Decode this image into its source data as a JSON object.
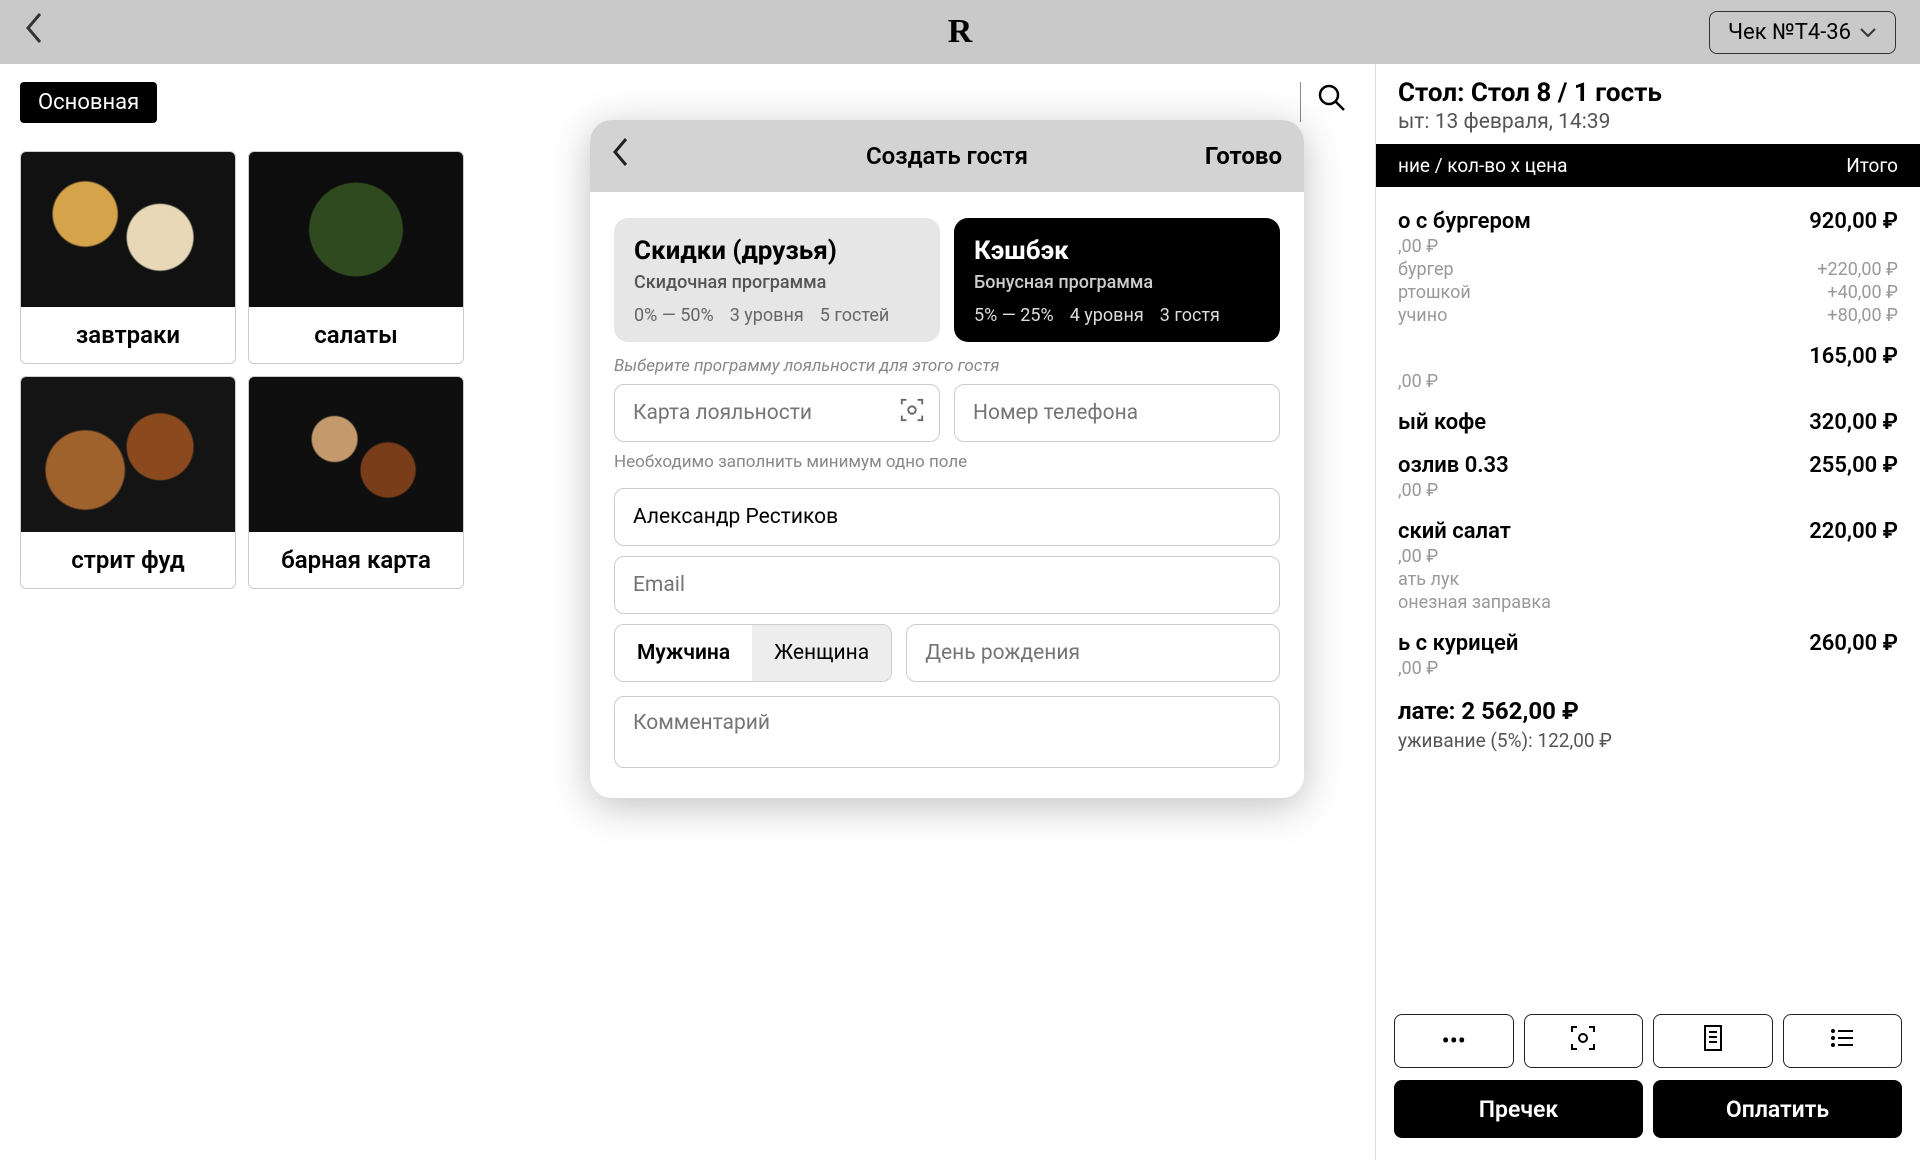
{
  "topbar": {
    "check_label": "Чек №Т4-36"
  },
  "menu": {
    "active_tab": "Основная",
    "categories": [
      {
        "label": "завтраки"
      },
      {
        "label": "салаты"
      },
      {
        "label": "стрит фуд"
      },
      {
        "label": "барная карта"
      }
    ]
  },
  "receipt": {
    "table_title": "Стол: Стол 8 / 1 гость",
    "opened": "ыт: 13 февраля, 14:39",
    "col_name": "ние / кол-во х цена",
    "col_total": "Итого",
    "items": [
      {
        "name": "о с бургером",
        "price": "920,00 ₽",
        "sub_price": ",00 ₽",
        "mods": [
          {
            "n": "бургер",
            "p": "+220,00 ₽"
          },
          {
            "n": "ртошкой",
            "p": "+40,00 ₽"
          },
          {
            "n": "учино",
            "p": "+80,00 ₽"
          }
        ]
      },
      {
        "name": "",
        "price": "165,00 ₽",
        "sub_price": ",00 ₽"
      },
      {
        "name": "ый кофе",
        "price": "320,00 ₽",
        "sub_price": ""
      },
      {
        "name": "озлив 0.33",
        "price": "255,00 ₽",
        "sub_price": ",00 ₽"
      },
      {
        "name": "ский салат",
        "price": "220,00 ₽",
        "sub_price": ",00 ₽",
        "mods": [
          {
            "n": "ать лук",
            "p": ""
          },
          {
            "n": "онезная заправка",
            "p": ""
          }
        ]
      },
      {
        "name": "ь с курицей",
        "price": "260,00 ₽",
        "sub_price": ",00 ₽"
      }
    ],
    "total_label": "лате: 2 562,00 ₽",
    "service_label": "уживание (5%): 122,00 ₽",
    "precheck": "Пречек",
    "pay": "Оплатить"
  },
  "modal": {
    "title": "Создать гостя",
    "done": "Готово",
    "loyalty": [
      {
        "title": "Скидки (друзья)",
        "sub": "Скидочная программа",
        "range": "0% — 50%",
        "levels": "3 уровня",
        "guests": "5 гостей"
      },
      {
        "title": "Кэшбэк",
        "sub": "Бонусная программа",
        "range": "5% — 25%",
        "levels": "4 уровня",
        "guests": "3 гостя"
      }
    ],
    "hint_program": "Выберите программу лояльности для этого гостя",
    "card_placeholder": "Карта лояльности",
    "phone_placeholder": "Номер телефона",
    "hint_fields": "Необходимо заполнить минимум одно поле",
    "name_value": "Александр Рестиков",
    "email_placeholder": "Email",
    "gender_male": "Мужчина",
    "gender_female": "Женщина",
    "dob_placeholder": "День рождения",
    "comment_placeholder": "Комментарий"
  }
}
